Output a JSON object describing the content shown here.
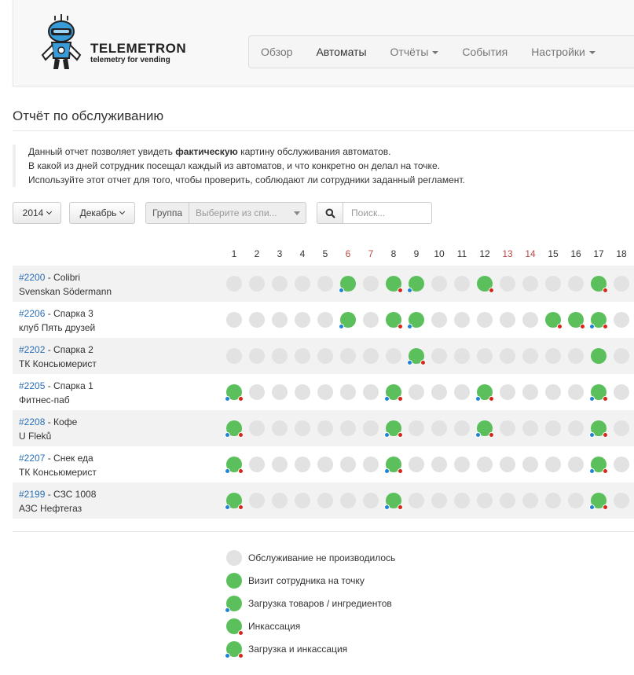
{
  "brand": {
    "title": "TELEMETRON",
    "subtitle": "telemetry for vending"
  },
  "nav": [
    {
      "label": "Обзор",
      "dropdown": false,
      "active": false
    },
    {
      "label": "Автоматы",
      "dropdown": false,
      "active": true
    },
    {
      "label": "Отчёты",
      "dropdown": true,
      "active": false
    },
    {
      "label": "События",
      "dropdown": false,
      "active": false
    },
    {
      "label": "Настройки",
      "dropdown": true,
      "active": false
    }
  ],
  "page": {
    "title": "Отчёт по обслуживанию",
    "description": {
      "line1_before": "Данный отчет позволяет увидеть ",
      "line1_bold": "фактическую",
      "line1_after": " картину обслуживания автоматов.",
      "line2": "В какой из дней сотрудник посещал каждый из автоматов, и что конкретно он делал на точке.",
      "line3": "Используйте этот отчет для того, чтобы проверить, соблюдают ли сотрудники заданный регламент."
    }
  },
  "filters": {
    "year": "2014",
    "month": "Декабрь",
    "group_label": "Группа",
    "group_placeholder": "Выберите из спи...",
    "search_placeholder": "Поиск..."
  },
  "days": [
    {
      "label": "1",
      "weekend": false
    },
    {
      "label": "2",
      "weekend": false
    },
    {
      "label": "3",
      "weekend": false
    },
    {
      "label": "4",
      "weekend": false
    },
    {
      "label": "5",
      "weekend": false
    },
    {
      "label": "6",
      "weekend": true
    },
    {
      "label": "7",
      "weekend": true
    },
    {
      "label": "8",
      "weekend": false
    },
    {
      "label": "9",
      "weekend": false
    },
    {
      "label": "10",
      "weekend": false
    },
    {
      "label": "11",
      "weekend": false
    },
    {
      "label": "12",
      "weekend": false
    },
    {
      "label": "13",
      "weekend": true
    },
    {
      "label": "14",
      "weekend": true
    },
    {
      "label": "15",
      "weekend": false
    },
    {
      "label": "16",
      "weekend": false
    },
    {
      "label": "17",
      "weekend": false
    },
    {
      "label": "18",
      "weekend": false
    }
  ],
  "status_codes": {
    "n": "Обслуживание не производилось",
    "v": "Визит сотрудника на точку",
    "l": "Загрузка товаров / ингредиентов",
    "c": "Инкассация",
    "lc": "Загрузка и инкассация"
  },
  "rows": [
    {
      "id": "#2200",
      "name": " - Colibri",
      "location": "Svenskan Södermann",
      "status": [
        "n",
        "n",
        "n",
        "n",
        "n",
        "l",
        "n",
        "c",
        "l",
        "n",
        "n",
        "c",
        "n",
        "n",
        "n",
        "n",
        "c",
        "n"
      ]
    },
    {
      "id": "#2206",
      "name": " - Спарка 3",
      "location": "клуб Пять друзей",
      "status": [
        "n",
        "n",
        "n",
        "n",
        "n",
        "l",
        "n",
        "c",
        "l",
        "n",
        "n",
        "n",
        "n",
        "n",
        "c",
        "c",
        "lc",
        "n"
      ]
    },
    {
      "id": "#2202",
      "name": " - Спарка 2",
      "location": "ТК Консьюмерист",
      "status": [
        "n",
        "n",
        "n",
        "n",
        "n",
        "n",
        "n",
        "n",
        "lc",
        "n",
        "n",
        "n",
        "n",
        "n",
        "n",
        "n",
        "v",
        "n"
      ]
    },
    {
      "id": "#2205",
      "name": " - Спарка 1",
      "location": "Фитнес-паб",
      "status": [
        "lc",
        "n",
        "n",
        "n",
        "n",
        "n",
        "n",
        "lc",
        "n",
        "n",
        "n",
        "lc",
        "n",
        "n",
        "n",
        "n",
        "lc",
        "n"
      ]
    },
    {
      "id": "#2208",
      "name": " - Кофе",
      "location": "U Fleků",
      "status": [
        "lc",
        "n",
        "n",
        "n",
        "n",
        "n",
        "n",
        "lc",
        "n",
        "n",
        "n",
        "lc",
        "n",
        "n",
        "n",
        "n",
        "lc",
        "n"
      ]
    },
    {
      "id": "#2207",
      "name": " - Снек еда",
      "location": "ТК Консьюмерист",
      "status": [
        "lc",
        "n",
        "n",
        "n",
        "n",
        "n",
        "n",
        "lc",
        "n",
        "n",
        "n",
        "n",
        "n",
        "n",
        "n",
        "n",
        "lc",
        "n"
      ]
    },
    {
      "id": "#2199",
      "name": " - СЗС 1008",
      "location": "АЗС Нефтегаз",
      "status": [
        "lc",
        "n",
        "n",
        "n",
        "n",
        "n",
        "n",
        "lc",
        "n",
        "n",
        "n",
        "n",
        "n",
        "n",
        "n",
        "n",
        "lc",
        "n"
      ]
    }
  ],
  "legend": [
    {
      "code": "n",
      "label": "Обслуживание не производилось"
    },
    {
      "code": "v",
      "label": "Визит сотрудника на точку"
    },
    {
      "code": "l",
      "label": "Загрузка товаров / ингредиентов"
    },
    {
      "code": "c",
      "label": "Инкассация"
    },
    {
      "code": "lc",
      "label": "Загрузка и инкассация"
    }
  ],
  "colors": {
    "visit": "#5bc05b",
    "none": "#e2e2e2",
    "load": "#1f84d5",
    "cash": "#d8261a",
    "link": "#2a6fb5",
    "weekend": "#b94a48"
  }
}
